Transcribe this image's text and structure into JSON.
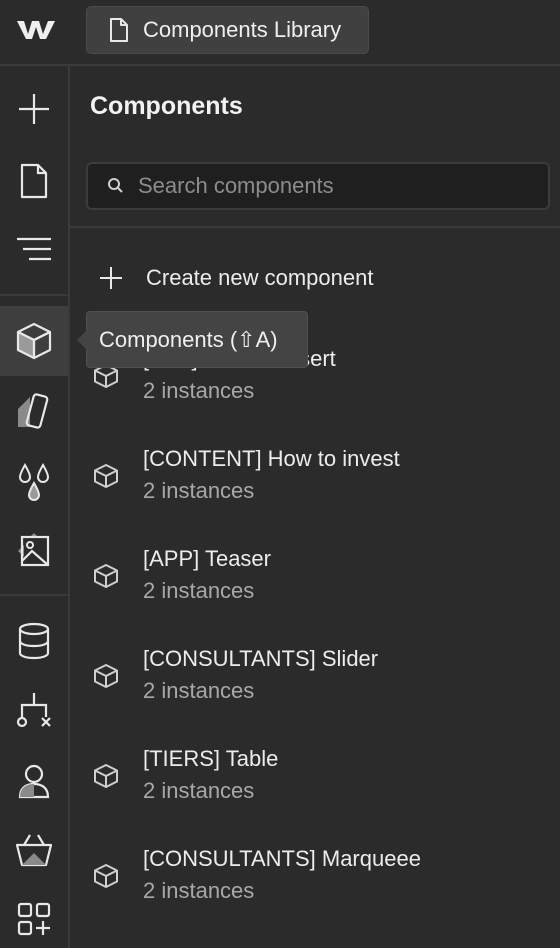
{
  "topbar": {
    "tab_label": "Components Library"
  },
  "rail": {
    "items": [
      {
        "icon": "plus-icon"
      },
      {
        "icon": "page-icon"
      },
      {
        "icon": "navigator-icon"
      },
      {
        "icon": "components-icon",
        "active": true
      },
      {
        "icon": "styles-icon"
      },
      {
        "icon": "variables-icon"
      },
      {
        "icon": "assets-icon"
      },
      {
        "icon": "cms-icon"
      },
      {
        "icon": "logic-icon"
      },
      {
        "icon": "users-icon"
      },
      {
        "icon": "ecommerce-icon"
      },
      {
        "icon": "apps-icon"
      }
    ]
  },
  "tooltip": {
    "text": "Components (⇧A)"
  },
  "panel": {
    "title": "Components",
    "search_placeholder": "Search components",
    "create_label": "Create new component",
    "components": [
      {
        "name": "[CTA] Banner Insert",
        "count": "2 instances"
      },
      {
        "name": "[CONTENT] How to invest",
        "count": "2 instances"
      },
      {
        "name": "[APP] Teaser",
        "count": "2 instances"
      },
      {
        "name": "[CONSULTANTS] Slider",
        "count": "2 instances"
      },
      {
        "name": "[TIERS] Table",
        "count": "2 instances"
      },
      {
        "name": "[CONSULTANTS] Marqueee",
        "count": "2 instances"
      }
    ]
  },
  "colors": {
    "background": "#2b2b2b",
    "active_rail": "#3e3e3e",
    "tooltip": "#444444"
  }
}
